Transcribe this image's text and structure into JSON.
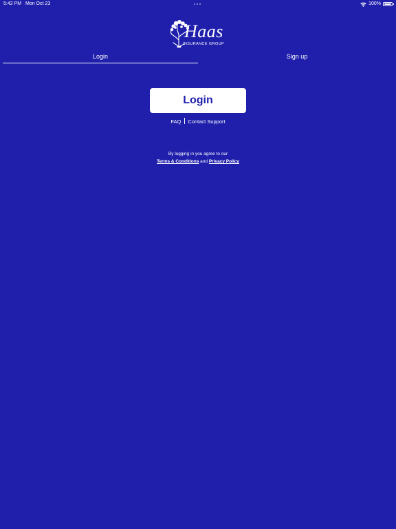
{
  "status_bar": {
    "time": "5:42 PM",
    "date": "Mon Oct 23",
    "battery": "100%"
  },
  "logo": {
    "word": "Haas",
    "sub": "INSURANCE GROUP"
  },
  "tabs": [
    {
      "label": "Login",
      "active": true
    },
    {
      "label": "Sign up",
      "active": false
    }
  ],
  "login_button": {
    "label": "Login"
  },
  "help": {
    "faq": "FAQ",
    "contact": "Contact Support"
  },
  "legal": {
    "intro": "By logging in you agree to our",
    "terms": "Terms & Conditions",
    "and": "and",
    "privacy": "Privacy Policy"
  },
  "colors": {
    "background": "#1f1fac",
    "button_bg": "#ffffff",
    "button_text": "#1f1fac",
    "text": "#ffffff"
  },
  "icons": [
    "wifi-icon",
    "battery-icon",
    "tree-icon"
  ]
}
